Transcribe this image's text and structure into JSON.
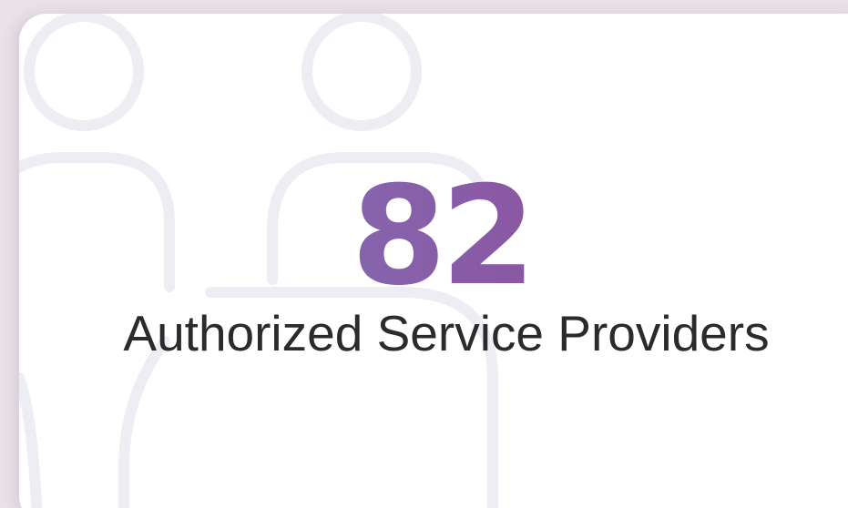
{
  "stat": {
    "value": "82",
    "label": "Authorized Service Providers"
  },
  "colors": {
    "gradient_start": "#7b82c0",
    "gradient_end": "#973f92",
    "label": "#2b2b2d",
    "illustration": "#eceef4",
    "card": "#ffffff"
  },
  "icons": [
    "users-icon"
  ]
}
